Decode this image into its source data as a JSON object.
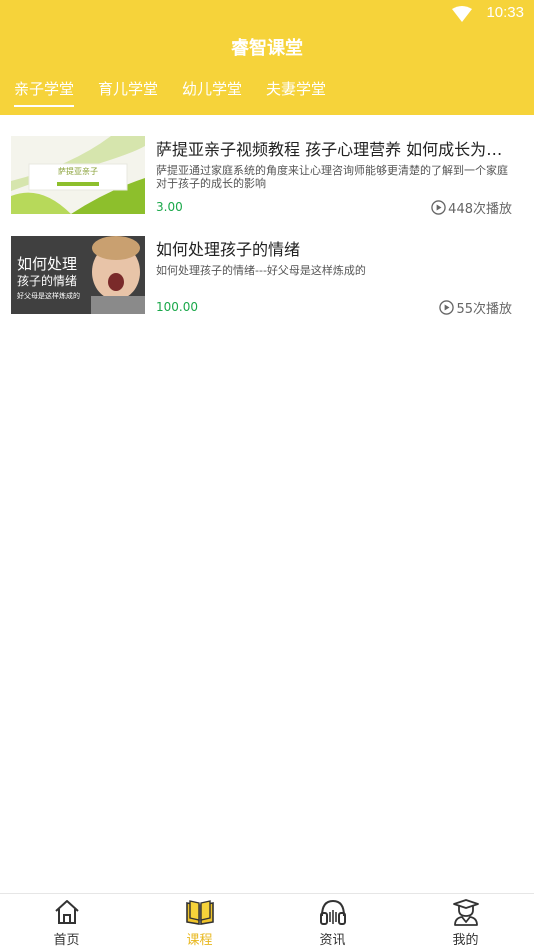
{
  "status": {
    "time": "10:33"
  },
  "header": {
    "title": "睿智课堂"
  },
  "tabs": [
    {
      "label": "亲子学堂",
      "active": true
    },
    {
      "label": "育儿学堂",
      "active": false
    },
    {
      "label": "幼儿学堂",
      "active": false
    },
    {
      "label": "夫妻学堂",
      "active": false
    }
  ],
  "courses": [
    {
      "title": "萨提亚亲子视频教程 孩子心理营养 如何成长为一...",
      "description": "萨提亚通过家庭系统的角度来让心理咨询师能够更清楚的了解到一个家庭对于孩子的成长的影响",
      "price": "3.00",
      "plays": "448次播放",
      "thumb_text": "萨提亚亲子"
    },
    {
      "title": "如何处理孩子的情绪",
      "description": "如何处理孩子的情绪---好父母是这样炼成的",
      "price": "100.00",
      "plays": "55次播放",
      "thumb_line1": "如何处理",
      "thumb_line2": "孩子的情绪",
      "thumb_line3": "好父母是这样炼成的"
    }
  ],
  "bottom_nav": [
    {
      "label": "首页",
      "icon": "home-icon",
      "active": false
    },
    {
      "label": "课程",
      "icon": "book-icon",
      "active": true
    },
    {
      "label": "资讯",
      "icon": "headphones-icon",
      "active": false
    },
    {
      "label": "我的",
      "icon": "graduate-icon",
      "active": false
    }
  ],
  "colors": {
    "accent": "#f6d33a",
    "price": "#1aa84a",
    "active_nav": "#e8b820"
  }
}
